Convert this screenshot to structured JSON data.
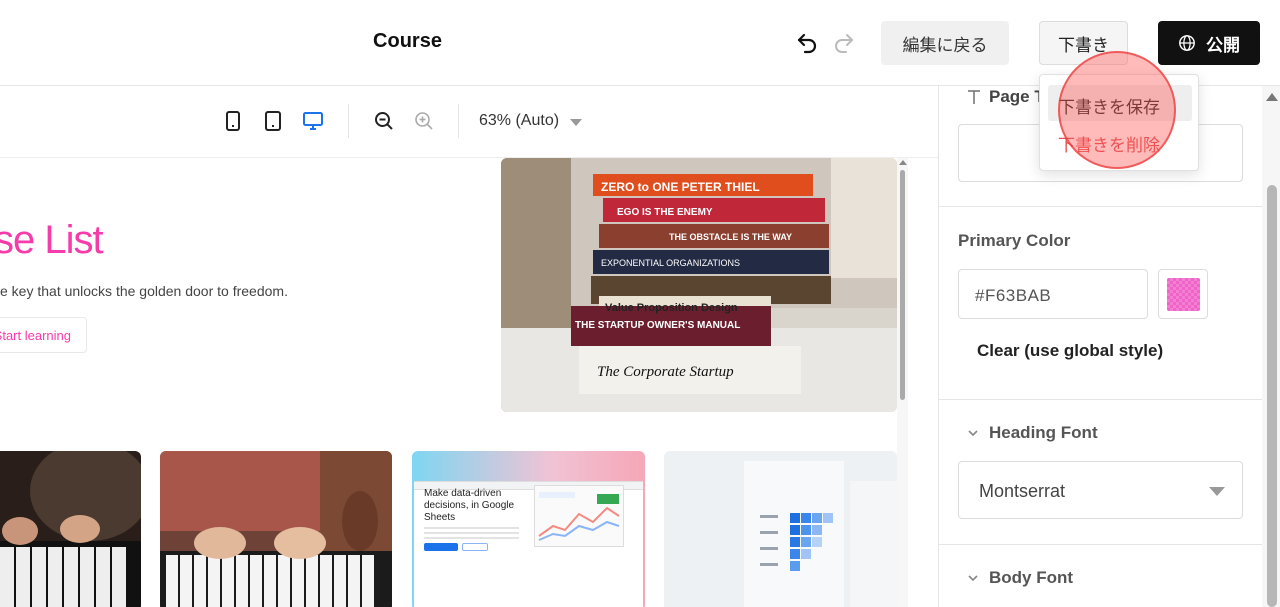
{
  "header": {
    "title": "Course",
    "back_to_edit": "編集に戻る",
    "draft": "下書き",
    "publish": "公開"
  },
  "draft_menu": {
    "save": "下書きを保存",
    "delete": "下書きを削除"
  },
  "toolbar": {
    "zoom": "63% (Auto)"
  },
  "canvas": {
    "hero_title": "se List",
    "hero_text": "e key that unlocks the golden door to freedom.",
    "hero_button": "Start learning",
    "sheets_card_heading": "Make data-driven decisions, in Google Sheets"
  },
  "book_spines": [
    "ZERO to ONE  PETER THIEL",
    "EGO IS THE ENEMY",
    "THE OBSTACLE IS THE WAY",
    "EXPONENTIAL ORGANIZATIONS",
    "Value Proposition Design",
    "THE STARTUP OWNER'S MANUAL",
    "The Corporate Startup"
  ],
  "settings": {
    "page_title_label": "Page T",
    "primary_color_label": "Primary Color",
    "primary_color_value": "#F63BAB",
    "clear_label": "Clear (use global style)",
    "heading_font_label": "Heading Font",
    "heading_font_value": "Montserrat",
    "body_font_label": "Body Font"
  },
  "colors": {
    "accent": "#F63BAB",
    "publish_bg": "#111111",
    "danger": "#E44C4C"
  },
  "icons": {
    "undo": "undo-icon",
    "redo": "redo-icon",
    "globe": "globe-icon",
    "phone": "phone-icon",
    "tablet": "tablet-icon",
    "desktop": "desktop-icon",
    "zoom_out": "zoom-out-icon",
    "zoom_in": "zoom-in-icon",
    "text": "text-icon",
    "chevron": "chevron-down-icon"
  }
}
